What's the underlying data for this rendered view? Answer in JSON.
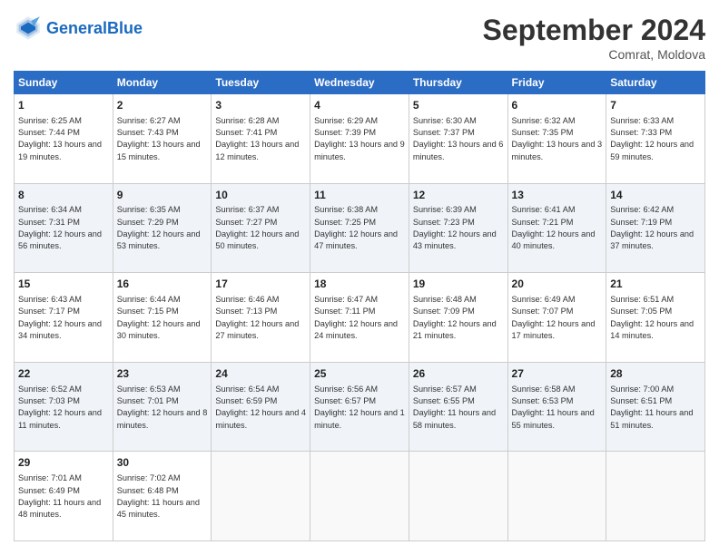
{
  "header": {
    "logo_general": "General",
    "logo_blue": "Blue",
    "month_title": "September 2024",
    "location": "Comrat, Moldova"
  },
  "days_of_week": [
    "Sunday",
    "Monday",
    "Tuesday",
    "Wednesday",
    "Thursday",
    "Friday",
    "Saturday"
  ],
  "weeks": [
    [
      {
        "day": "1",
        "sunrise": "6:25 AM",
        "sunset": "7:44 PM",
        "daylight": "13 hours and 19 minutes."
      },
      {
        "day": "2",
        "sunrise": "6:27 AM",
        "sunset": "7:43 PM",
        "daylight": "13 hours and 15 minutes."
      },
      {
        "day": "3",
        "sunrise": "6:28 AM",
        "sunset": "7:41 PM",
        "daylight": "13 hours and 12 minutes."
      },
      {
        "day": "4",
        "sunrise": "6:29 AM",
        "sunset": "7:39 PM",
        "daylight": "13 hours and 9 minutes."
      },
      {
        "day": "5",
        "sunrise": "6:30 AM",
        "sunset": "7:37 PM",
        "daylight": "13 hours and 6 minutes."
      },
      {
        "day": "6",
        "sunrise": "6:32 AM",
        "sunset": "7:35 PM",
        "daylight": "13 hours and 3 minutes."
      },
      {
        "day": "7",
        "sunrise": "6:33 AM",
        "sunset": "7:33 PM",
        "daylight": "12 hours and 59 minutes."
      }
    ],
    [
      {
        "day": "8",
        "sunrise": "6:34 AM",
        "sunset": "7:31 PM",
        "daylight": "12 hours and 56 minutes."
      },
      {
        "day": "9",
        "sunrise": "6:35 AM",
        "sunset": "7:29 PM",
        "daylight": "12 hours and 53 minutes."
      },
      {
        "day": "10",
        "sunrise": "6:37 AM",
        "sunset": "7:27 PM",
        "daylight": "12 hours and 50 minutes."
      },
      {
        "day": "11",
        "sunrise": "6:38 AM",
        "sunset": "7:25 PM",
        "daylight": "12 hours and 47 minutes."
      },
      {
        "day": "12",
        "sunrise": "6:39 AM",
        "sunset": "7:23 PM",
        "daylight": "12 hours and 43 minutes."
      },
      {
        "day": "13",
        "sunrise": "6:41 AM",
        "sunset": "7:21 PM",
        "daylight": "12 hours and 40 minutes."
      },
      {
        "day": "14",
        "sunrise": "6:42 AM",
        "sunset": "7:19 PM",
        "daylight": "12 hours and 37 minutes."
      }
    ],
    [
      {
        "day": "15",
        "sunrise": "6:43 AM",
        "sunset": "7:17 PM",
        "daylight": "12 hours and 34 minutes."
      },
      {
        "day": "16",
        "sunrise": "6:44 AM",
        "sunset": "7:15 PM",
        "daylight": "12 hours and 30 minutes."
      },
      {
        "day": "17",
        "sunrise": "6:46 AM",
        "sunset": "7:13 PM",
        "daylight": "12 hours and 27 minutes."
      },
      {
        "day": "18",
        "sunrise": "6:47 AM",
        "sunset": "7:11 PM",
        "daylight": "12 hours and 24 minutes."
      },
      {
        "day": "19",
        "sunrise": "6:48 AM",
        "sunset": "7:09 PM",
        "daylight": "12 hours and 21 minutes."
      },
      {
        "day": "20",
        "sunrise": "6:49 AM",
        "sunset": "7:07 PM",
        "daylight": "12 hours and 17 minutes."
      },
      {
        "day": "21",
        "sunrise": "6:51 AM",
        "sunset": "7:05 PM",
        "daylight": "12 hours and 14 minutes."
      }
    ],
    [
      {
        "day": "22",
        "sunrise": "6:52 AM",
        "sunset": "7:03 PM",
        "daylight": "12 hours and 11 minutes."
      },
      {
        "day": "23",
        "sunrise": "6:53 AM",
        "sunset": "7:01 PM",
        "daylight": "12 hours and 8 minutes."
      },
      {
        "day": "24",
        "sunrise": "6:54 AM",
        "sunset": "6:59 PM",
        "daylight": "12 hours and 4 minutes."
      },
      {
        "day": "25",
        "sunrise": "6:56 AM",
        "sunset": "6:57 PM",
        "daylight": "12 hours and 1 minute."
      },
      {
        "day": "26",
        "sunrise": "6:57 AM",
        "sunset": "6:55 PM",
        "daylight": "11 hours and 58 minutes."
      },
      {
        "day": "27",
        "sunrise": "6:58 AM",
        "sunset": "6:53 PM",
        "daylight": "11 hours and 55 minutes."
      },
      {
        "day": "28",
        "sunrise": "7:00 AM",
        "sunset": "6:51 PM",
        "daylight": "11 hours and 51 minutes."
      }
    ],
    [
      {
        "day": "29",
        "sunrise": "7:01 AM",
        "sunset": "6:49 PM",
        "daylight": "11 hours and 48 minutes."
      },
      {
        "day": "30",
        "sunrise": "7:02 AM",
        "sunset": "6:48 PM",
        "daylight": "11 hours and 45 minutes."
      },
      null,
      null,
      null,
      null,
      null
    ]
  ]
}
